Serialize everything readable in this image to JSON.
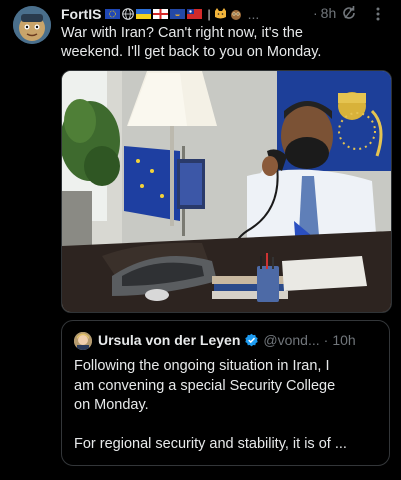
{
  "tweet": {
    "author_name": "FortIS",
    "name_emojis_after_flags": "|",
    "overflow": "...",
    "time": "8h",
    "text_lines": [
      "War with Iran? Can't right now, it's the",
      "weekend. I'll get back to you on Monday."
    ]
  },
  "quote": {
    "name": "Ursula von der Leyen",
    "handle": "@vond...",
    "separator": "·",
    "time": "10h",
    "lines": [
      "Following the ongoing situation in Iran, I",
      "am convening a special Security College",
      "on Monday.",
      "",
      "For regional security and stability, it is of ..."
    ]
  },
  "colors": {
    "background": "#000000",
    "text": "#e7e9ea",
    "muted": "#71767b",
    "border": "#333639",
    "verified": "#1d9bf0"
  },
  "icons": [
    "avatar-cartoon",
    "eu-flag-icon",
    "globe-icon",
    "ukraine-flag-icon",
    "georgia-flag-icon",
    "kosovo-flag-icon",
    "taiwan-flag-icon",
    "cat-emoji-icon",
    "owl-emoji-icon",
    "grok-sync-icon",
    "more-vertical-icon",
    "verified-badge-icon"
  ]
}
